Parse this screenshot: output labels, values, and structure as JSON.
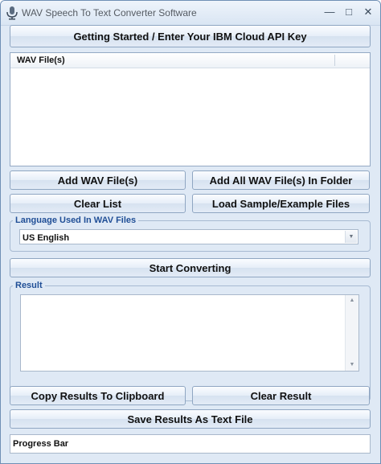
{
  "window": {
    "title": "WAV Speech To Text Converter Software",
    "minimize_glyph": "—",
    "maximize_glyph": "□",
    "close_glyph": "✕",
    "icon": "microphone-icon"
  },
  "buttons": {
    "getting_started": "Getting Started / Enter Your IBM Cloud API Key",
    "add_files": "Add WAV File(s)",
    "add_folder": "Add All WAV File(s) In Folder",
    "clear_list": "Clear List",
    "load_sample": "Load Sample/Example Files",
    "start": "Start Converting",
    "copy": "Copy Results To Clipboard",
    "clear_result": "Clear Result",
    "save": "Save Results As Text File"
  },
  "file_list": {
    "columns": [
      "WAV File(s)",
      ""
    ],
    "rows": []
  },
  "language": {
    "legend": "Language Used In WAV Files",
    "selected": "US English"
  },
  "result": {
    "legend": "Result",
    "value": ""
  },
  "progress": {
    "label": "Progress Bar"
  },
  "glyphs": {
    "combo_arrow": "▼",
    "scroll_up": "▲",
    "scroll_down": "▼"
  },
  "colors": {
    "background": "#dfe9f5",
    "legend": "#1f4e96",
    "border": "#8fa6c2"
  }
}
